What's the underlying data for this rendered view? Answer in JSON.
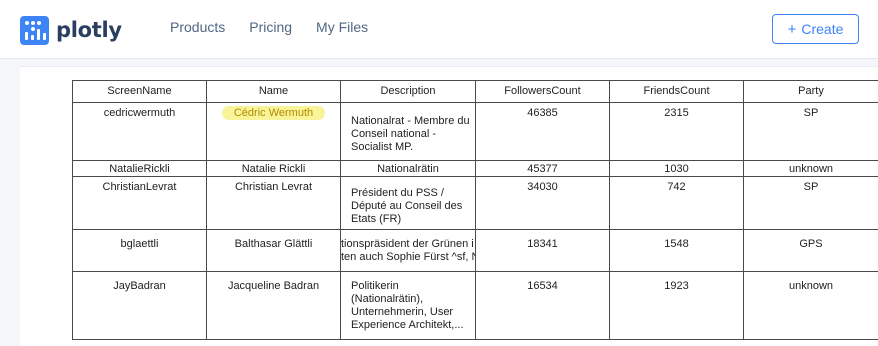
{
  "brand": {
    "name": "plotly",
    "accent": "#3d84f7"
  },
  "nav": {
    "items": [
      "Products",
      "Pricing",
      "My Files"
    ]
  },
  "create_button": {
    "label": "Create",
    "icon": "plus-icon"
  },
  "table": {
    "headers": [
      "ScreenName",
      "Name",
      "Description",
      "FollowersCount",
      "FriendsCount",
      "Party"
    ],
    "rows": [
      {
        "screen_name": "cedricwermuth",
        "name": "Cédric Wermuth",
        "description": "Nationalrat - Membre du Conseil national - Socialist MP.",
        "followers": "46385",
        "friends": "2315",
        "party": "SP"
      },
      {
        "screen_name": "NatalieRickli",
        "name": "Natalie Rickli",
        "description": "Nationalrätin",
        "followers": "45377",
        "friends": "1030",
        "party": "unknown"
      },
      {
        "screen_name": "ChristianLevrat",
        "name": "Christian Levrat",
        "description": "Président du PSS / Député au Conseil des Etats (FR)",
        "followers": "34030",
        "friends": "742",
        "party": "SP"
      },
      {
        "screen_name": "bglaettli",
        "name": "Balthasar Glättli",
        "description_line1": "tionspräsident der Grünen i",
        "description_line2": "ten auch Sophie Fürst ^sf, N",
        "followers": "18341",
        "friends": "1548",
        "party": "GPS"
      },
      {
        "screen_name": "JayBadran",
        "name": "Jacqueline Badran",
        "description": "Politikerin (Nationalrätin), Unternehmerin, User Experience Architekt,...",
        "followers": "16534",
        "friends": "1923",
        "party": "unknown"
      }
    ]
  }
}
